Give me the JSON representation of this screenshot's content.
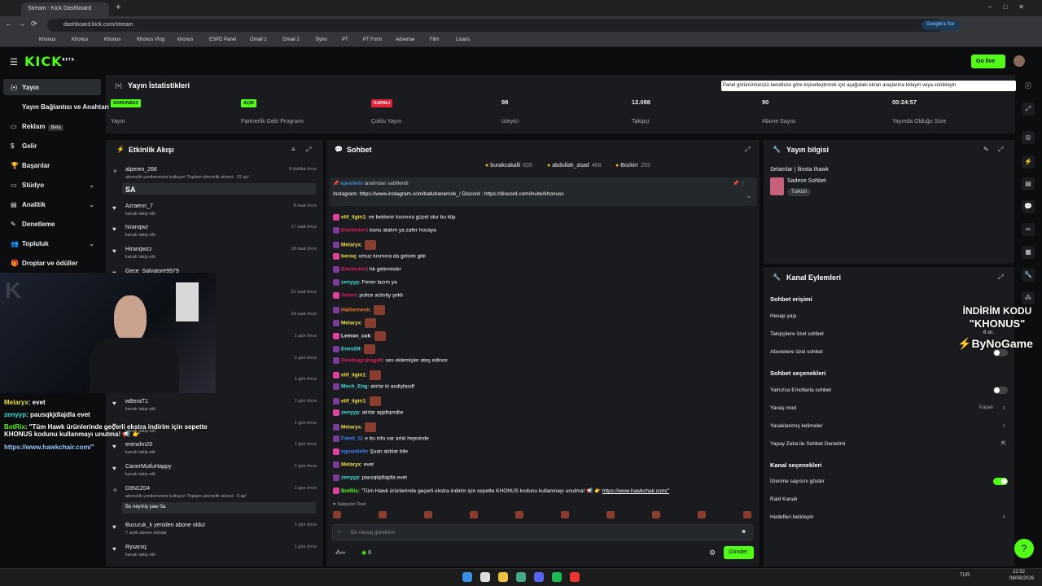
{
  "browser": {
    "tab_title": "Stream - Kick Dashboard",
    "url": "dashboard.kick.com/stream",
    "search_pill": "Google'a Sor",
    "bookmarks": [
      "Khonus",
      "Khonus",
      "Khonus",
      "Khonus Vlog",
      "khonus",
      "ESPD Panel",
      "Gmail 1",
      "Gmail 2",
      "Byno",
      "PT",
      "PT Form",
      "Adsense",
      "Film",
      "Lisans"
    ]
  },
  "header": {
    "logo": "KICK",
    "logo_badge": "BETA",
    "go_live": "Go live"
  },
  "sidebar": {
    "items": [
      "Yayın",
      "Yayın Bağlantısı ve Anahtarı",
      "Reklam",
      "Gelir",
      "Başarılar",
      "Stüdyo",
      "Analitik",
      "Denetleme",
      "Topluluk",
      "Droplar ve ödüller"
    ],
    "beta": "Beta"
  },
  "stats": {
    "title": "Yayın İstatistikleri",
    "tooltip": "Panel görünümünüzü kendinize göre kişiselleştirmek için aşağıdaki ekran araçlarına tıklayın veya sürükleyin",
    "boxes": [
      {
        "badge": "SORUNSUZ",
        "label": "Yayın",
        "badge_color": "#53fc18"
      },
      {
        "badge": "AÇIK",
        "label": "Partnerlik Gelir Programı",
        "badge_color": "#53fc18"
      },
      {
        "badge": "KAPALI",
        "label": "Çoklu Yayın",
        "badge_color": "#e0243a"
      },
      {
        "value": "98",
        "label": "İzleyici"
      },
      {
        "value": "12.088",
        "label": "Takipçi"
      },
      {
        "value": "90",
        "label": "Abone Sayısı"
      },
      {
        "value": "00:24:57",
        "label": "Yayında Olduğu Süre"
      }
    ]
  },
  "feed": {
    "title": "Etkinlik Akışı",
    "items": [
      {
        "name": "alperen_266",
        "sub": "abonelik yenilemesini kutluyor! Toplam abonelik süresi - 22 ay!",
        "time": "8 dakika önce",
        "msg": "SA"
      },
      {
        "name": "Azraenn_7",
        "sub": "kanalı takip etti",
        "time": "8 saat önce"
      },
      {
        "name": "hiranqwz",
        "sub": "kanalı takip etti",
        "time": "17 saat önce"
      },
      {
        "name": "Hiranqwzz",
        "sub": "kanalı takip etti",
        "time": "18 saat önce"
      },
      {
        "name": "Gece_Salvatore9979",
        "sub": "",
        "time": ""
      },
      {
        "name": "",
        "sub": "",
        "time": "21 saat önce"
      },
      {
        "name": "",
        "sub": "",
        "time": "23 saat önce"
      },
      {
        "name": "",
        "sub": "",
        "time": "1 gün önce"
      },
      {
        "name": "",
        "sub": "",
        "time": "1 gün önce"
      },
      {
        "name": "",
        "sub": "",
        "time": "1 gün önce"
      },
      {
        "name": "wBeraT1",
        "sub": "kanalı takip etti",
        "time": "1 gün önce"
      },
      {
        "name": "",
        "sub": "kanalı takip etti",
        "time": "1 gün önce"
      },
      {
        "name": "erenshn20",
        "sub": "kanalı takip etti",
        "time": "1 gün önce"
      },
      {
        "name": "CanerMutluHappy",
        "sub": "kanalı takip etti",
        "time": "1 gün önce"
      },
      {
        "name": "D3N1Z04",
        "sub": "abonelik yenilemesini kutluyor! Toplam abonelik süresi - 9 ay!",
        "time": "1 gün önce",
        "msg": "Bu neymiş yaw Sa"
      },
      {
        "name": "Bucuruk_k yeniden abone oldu!",
        "sub": "7 aylık abone oldular",
        "time": "1 gün önce"
      },
      {
        "name": "Rysarxq",
        "sub": "kanalı takip etti",
        "time": "1 gün önce"
      }
    ]
  },
  "overlay": {
    "lines": [
      {
        "user": "Melaryx",
        "text": ": evet"
      },
      {
        "user": "zenyyp",
        "text": ": pausqkjdlajdla evet"
      },
      {
        "user": "BotRix",
        "text": ": \"Tüm Hawk ürünlerinde geçerli ekstra indirim için sepette KHONUS kodunu kullanmayı unutma! 📢 👉"
      },
      {
        "user": "",
        "text": "https://www.hawkchair.com/\""
      }
    ]
  },
  "chat": {
    "title": "Sohbet",
    "top_gifters": [
      {
        "name": "burakcakalli",
        "n": "635"
      },
      {
        "name": "abdullah_asad",
        "n": "468"
      },
      {
        "name": "Bozkirr",
        "n": "293"
      }
    ],
    "pinned_by": "tarafından sabitlendi",
    "pinned_user": "egeanliefe",
    "pinned_text": "Instagram: https://www.instagram.com/batuhanercok_/ Discord : https://discord.com/invite/khonuss",
    "messages": [
      {
        "user": "elif_ilgin1",
        "color": "#f0e040",
        "text": ": ne beklenir kısmına güzel olur bu klip"
      },
      {
        "user": "Emrlecleri",
        "color": "#e02060",
        "text": ": bunu atalım ya zafer hocaya"
      },
      {
        "user": "Melaryx",
        "color": "#f0e040",
        "text": ":",
        "emote": true
      },
      {
        "user": "beroq",
        "color": "#f0e040",
        "text": ": omuz kısmına da gelcek gibi"
      },
      {
        "user": "Emrlecleri",
        "color": "#e02060",
        "text": ": hk getirmisler"
      },
      {
        "user": "zenyyp",
        "color": "#40e0e0",
        "text": ": Fener lazım ya"
      },
      {
        "user": "Jenen",
        "color": "#e02060",
        "text": ": police activity şekli"
      },
      {
        "user": "Haliterneck",
        "color": "#f07830",
        "text": ":",
        "emote": true
      },
      {
        "user": "Melaryx",
        "color": "#f0e040",
        "text": ":",
        "emote": true
      },
      {
        "user": "Lemon_cuk",
        "color": "#e8e8e8",
        "text": ":",
        "emote": true
      },
      {
        "user": "EnesS9",
        "color": "#40e0e0",
        "text": ":",
        "emote": true
      },
      {
        "user": "Sinebugrabagdli",
        "color": "#e02060",
        "text": ": ses eklemişler ateş edince"
      },
      {
        "user": "elif_ilgin1",
        "color": "#f0e040",
        "text": ":",
        "emote": true
      },
      {
        "user": "Mech_Eng",
        "color": "#40e0e0",
        "text": ": alırlar ki asdişfasdf"
      },
      {
        "user": "elif_ilgin1",
        "color": "#f0e040",
        "text": ":",
        "emote": true
      },
      {
        "user": "zenyyp",
        "color": "#40e0e0",
        "text": ": alırlar apjdlqmdlw"
      },
      {
        "user": "Melaryx",
        "color": "#f0e040",
        "text": ":",
        "emote": true
      },
      {
        "user": "Famil_G",
        "color": "#4080ff",
        "text": ": e bu info var artık hepsinde"
      },
      {
        "user": "egeanliefe",
        "color": "#4080ff",
        "text": ": Şuan aldılar bile"
      },
      {
        "user": "Melaryx",
        "color": "#f0e040",
        "text": ": evet"
      },
      {
        "user": "zenyyp",
        "color": "#40e0e0",
        "text": ": pausqkjdlajdla evet"
      },
      {
        "user": "BotRix",
        "color": "#53fc18",
        "text": ": \"Tüm Hawk ürünlerinde geçerli ekstra indirim için sepette KHONUS kodunu kullanmayı unutma! 📢 👉 ",
        "link": "https://www.hawkchair.com/\""
      }
    ],
    "followers_only": "Takipçiler Özel",
    "placeholder": "Bir mesaj gönderin",
    "send": "Gönder",
    "points": "0"
  },
  "info": {
    "title": "Yayın bilgisi",
    "stream_title": "Selamlar | İlinsta Ihawk",
    "category": "Sadece Sohbet",
    "tag": "Turkish"
  },
  "actions": {
    "title": "Kanal Eylemleri",
    "chat_access": "Sohbet erişimi",
    "account_age": "Hesap yaşı",
    "followers_only": "Takipçilere özel sohbet",
    "subs_only": "Abonelere özel sohbet",
    "chat_options": "Sohbet seçenekleri",
    "emotes_only": "Yalnızca Emotlarla sohbet",
    "slow_mode": "Yavaş mod",
    "slow_value": "Kapalı",
    "banned_words": "Yasaklanmış kelimeler",
    "ai_mod": "Yapay Zeka ile Sohbet Denetimi",
    "channel_options": "Kanal seçenekleri",
    "show_viewers": "İzlenme sayısını göster",
    "raid": "Raid Kanalı",
    "goals": "Hedefleri belirleyin"
  },
  "promo": {
    "line1": "İNDİRİM KODU",
    "line2": "\"KHONUS\"",
    "timer": "6 sn.",
    "brand": "ByNoGame"
  },
  "taskbar": {
    "lang": "TUR",
    "time": "22:52",
    "date": "06/08/2026"
  }
}
